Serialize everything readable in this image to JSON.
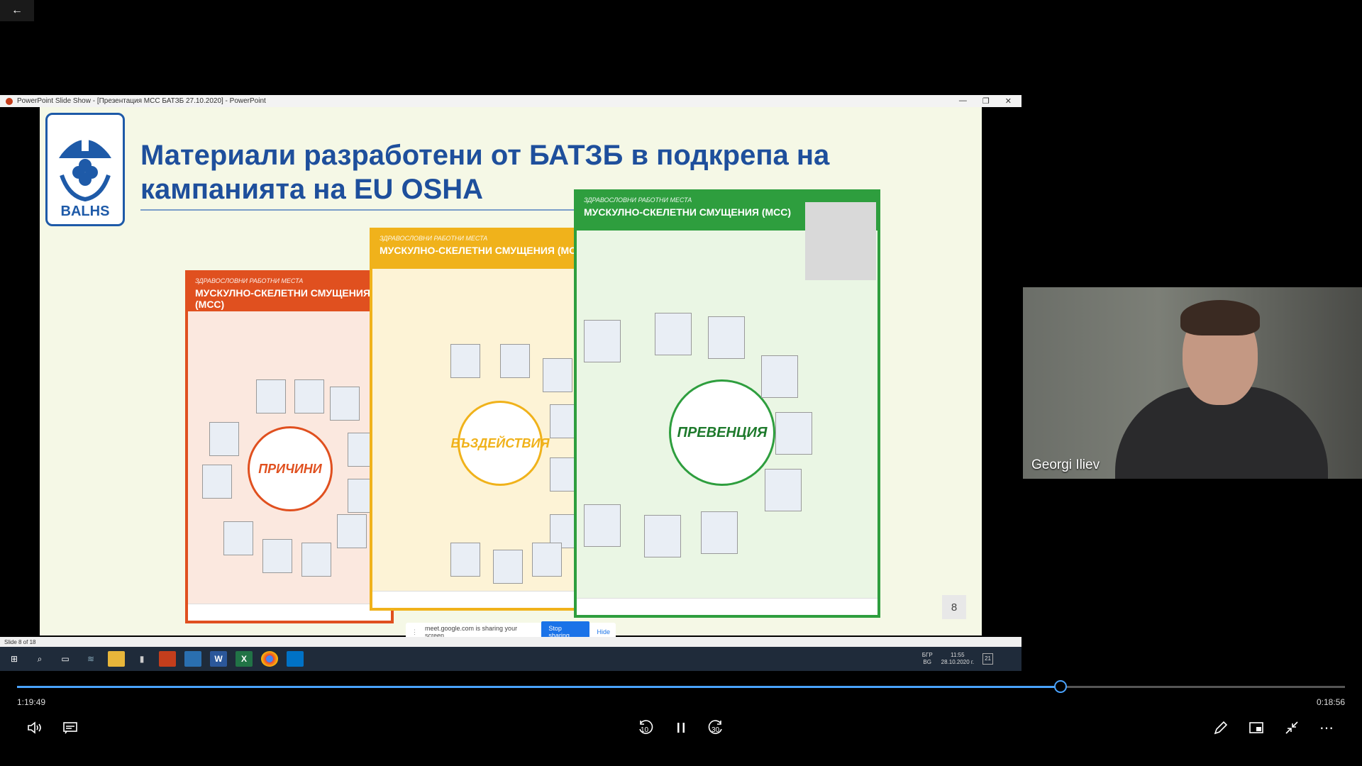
{
  "player": {
    "back_label": "←",
    "time_current": "1:19:49",
    "time_remaining": "0:18:56",
    "progress_fraction": 0.786
  },
  "powerpoint": {
    "window_title": "PowerPoint Slide Show - [Презентация МСС БАТЗБ 27.10.2020] - PowerPoint",
    "minimize": "—",
    "restore": "❐",
    "close": "✕",
    "status": "Slide 8 of 18"
  },
  "slide": {
    "logo_text": "BALHS",
    "title": "Материали разработени от БАТЗБ в подкрепа на кампанията на EU OSHA",
    "number": "8",
    "posters": [
      {
        "header_sub": "ЗДРАВОСЛОВНИ РАБОТНИ МЕСТА",
        "header_main": "МУСКУЛНО-СКЕЛЕТНИ СМУЩЕНИЯ (МСС)",
        "hub": "ПРИЧИНИ",
        "accent": "#e0501f"
      },
      {
        "header_sub": "ЗДРАВОСЛОВНИ РАБОТНИ МЕСТА",
        "header_main": "МУСКУЛНО-СКЕЛЕТНИ СМУЩЕНИЯ (МСС)",
        "hub": "ВЪЗДЕЙСТВИЯ",
        "accent": "#f0b21b"
      },
      {
        "header_sub": "ЗДРАВОСЛОВНИ РАБОТНИ МЕСТА",
        "header_main": "МУСКУЛНО-СКЕЛЕТНИ СМУЩЕНИЯ (МСС)",
        "hub": "ПРЕВЕНЦИЯ",
        "accent": "#2e9e3e"
      }
    ]
  },
  "share_bar": {
    "message": "meet.google.com is sharing your screen.",
    "stop_label": "Stop sharing",
    "hide_label": "Hide"
  },
  "taskbar": {
    "lang_top": "БГР",
    "lang_bottom": "BG",
    "clock_time": "11:55",
    "clock_date": "28.10.2020 г.",
    "notif_count": "21"
  },
  "participant": {
    "name": "Georgi Iliev"
  },
  "controls": {
    "skip_back": "10",
    "skip_forward": "30"
  }
}
